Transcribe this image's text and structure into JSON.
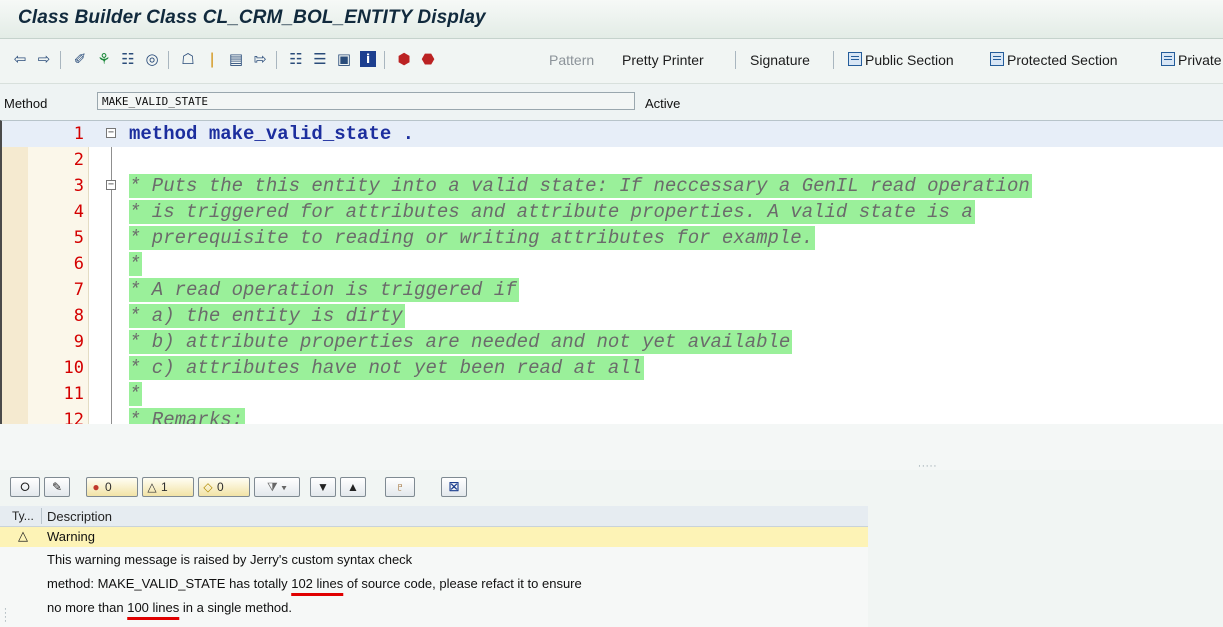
{
  "window": {
    "title": "Class Builder Class CL_CRM_BOL_ENTITY Display"
  },
  "toolbar": {
    "icons": [
      "arrow-left-icon",
      "arrow-right-icon",
      "check-icon",
      "activate-icon",
      "where-used-icon",
      "display-object-list-icon",
      "hierarchy-icon",
      "info-icon",
      "object-icon",
      "transfer-icon",
      "local-types-icon",
      "structure-icon",
      "details-icon",
      "help-icon",
      "breakpoint-icon",
      "breakpoint-remove-icon"
    ],
    "pattern_label": "Pattern",
    "pretty_printer_label": "Pretty Printer",
    "signature_label": "Signature",
    "public_section_label": "Public Section",
    "protected_section_label": "Protected Section",
    "private_section_label": "Private"
  },
  "method_row": {
    "label": "Method",
    "value": "MAKE_VALID_STATE",
    "status": "Active"
  },
  "editor": {
    "lines": [
      {
        "num": "1",
        "text": "method make_valid_state .",
        "kind": "keyword",
        "fold": "⊟"
      },
      {
        "num": "2",
        "text": "",
        "kind": "plain",
        "fold": ""
      },
      {
        "num": "3",
        "text": "* Puts the this entity into a valid state: If neccessary a GenIL read operation",
        "kind": "comment",
        "fold": "⊟"
      },
      {
        "num": "4",
        "text": "* is triggered for attributes and attribute properties. A valid state is a",
        "kind": "comment",
        "fold": ""
      },
      {
        "num": "5",
        "text": "* prerequisite to reading or writing attributes for example.",
        "kind": "comment",
        "fold": ""
      },
      {
        "num": "6",
        "text": "*",
        "kind": "comment",
        "fold": ""
      },
      {
        "num": "7",
        "text": "* A read operation is triggered if",
        "kind": "comment",
        "fold": ""
      },
      {
        "num": "8",
        "text": "* a) the entity is dirty",
        "kind": "comment",
        "fold": ""
      },
      {
        "num": "9",
        "text": "* b) attribute properties are needed and not yet available",
        "kind": "comment",
        "fold": ""
      },
      {
        "num": "10",
        "text": "* c) attributes have not yet been read at all",
        "kind": "comment",
        "fold": ""
      },
      {
        "num": "11",
        "text": "*",
        "kind": "comment",
        "fold": ""
      },
      {
        "num": "12",
        "text": "* Remarks:",
        "kind": "comment",
        "fold": ""
      }
    ]
  },
  "messages": {
    "toolbar": {
      "error_count": "0",
      "warning_count": "1",
      "info_count": "0"
    },
    "columns": {
      "type": "Ty...",
      "description": "Description"
    },
    "warning_label": "Warning",
    "line1": "This warning message is raised by Jerry's custom syntax check",
    "line2_pre": "method: MAKE_VALID_STATE has totally ",
    "line2_highlight": "102 lines",
    "line2_post": " of source code, please refact it to ensure",
    "line3_pre": "no more than ",
    "line3_highlight": "100 lines",
    "line3_post": " in a single method."
  },
  "colors": {
    "comment_bg": "#9af09a",
    "keyword": "#1c2e9e",
    "line_number": "#d40000",
    "warning_row": "#fdf3b6",
    "underline": "#e00000"
  }
}
